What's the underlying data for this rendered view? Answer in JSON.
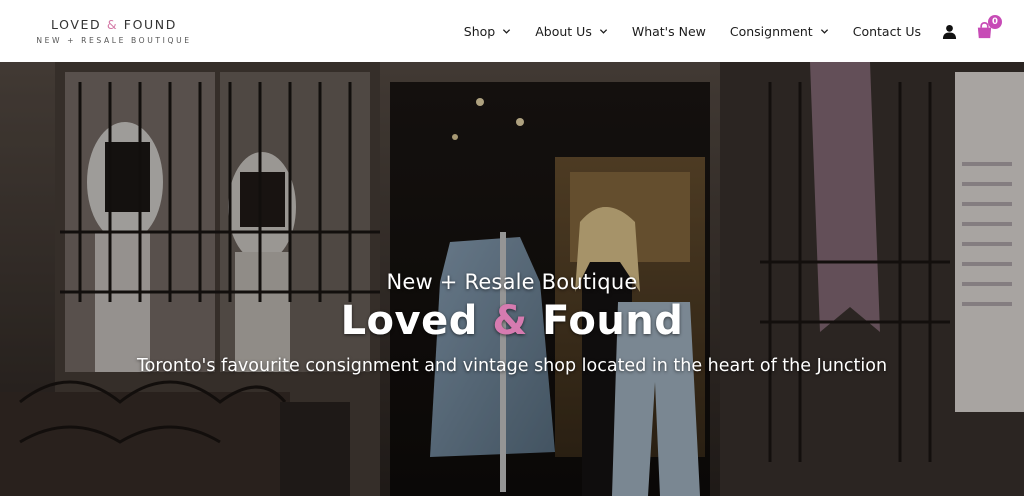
{
  "brand": {
    "name_part1": "LOVED",
    "ampersand": "&",
    "name_part2": "FOUND",
    "tagline": "NEW + RESALE BOUTIQUE",
    "accent_color": "#d479a6"
  },
  "nav": {
    "items": [
      {
        "label": "Shop",
        "has_dropdown": true
      },
      {
        "label": "About Us",
        "has_dropdown": true
      },
      {
        "label": "What's New",
        "has_dropdown": false
      },
      {
        "label": "Consignment",
        "has_dropdown": true
      },
      {
        "label": "Contact Us",
        "has_dropdown": false
      }
    ],
    "account_icon": "user-icon",
    "cart_icon": "shopping-bag-icon",
    "cart_count": "0",
    "cart_badge_color": "#c74bb6"
  },
  "hero": {
    "subtitle": "New + Resale Boutique",
    "title_part1": "Loved",
    "title_amp": "&",
    "title_part2": "Found",
    "description": "Toronto's favourite consignment and vintage shop located in the heart of the Junction",
    "image_description_icon": "storefront-photo"
  }
}
